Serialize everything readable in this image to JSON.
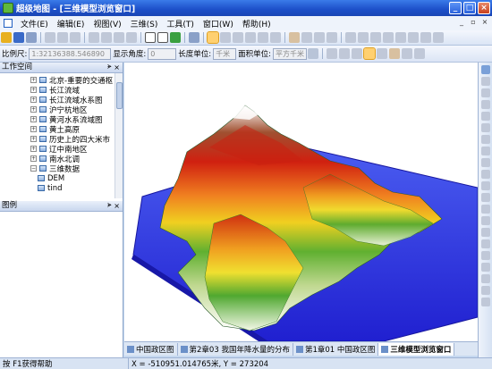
{
  "window": {
    "title": "超级地图 - [三维模型浏览窗口]",
    "minimize": "_",
    "maximize": "□",
    "close": "×"
  },
  "menu": {
    "items": [
      "文件(E)",
      "编辑(E)",
      "视图(V)",
      "三维(S)",
      "工具(T)",
      "窗口(W)",
      "帮助(H)"
    ],
    "mdi_buttons": [
      "_",
      "▫",
      "×"
    ]
  },
  "toolbar2": {
    "scale_label": "比例尺:",
    "scale_value": "1:32136388.546890",
    "display_angle_label": "显示角度:",
    "display_angle_value": "0",
    "length_unit_label": "长度单位:",
    "length_unit_value": "千米",
    "area_unit_label": "面积单位:",
    "area_unit_value": "平方千米"
  },
  "workspace": {
    "title": "工作空间",
    "pin": "ᗘ",
    "close": "×",
    "tree": [
      {
        "label": "北京-重要的交通枢",
        "expander": "+",
        "level": 0
      },
      {
        "label": "长江流域",
        "expander": "+",
        "level": 0
      },
      {
        "label": "长江流域水系图",
        "expander": "+",
        "level": 0
      },
      {
        "label": "沪宁杭地区",
        "expander": "+",
        "level": 0
      },
      {
        "label": "黄河水系流域图",
        "expander": "+",
        "level": 0
      },
      {
        "label": "黄土高原",
        "expander": "+",
        "level": 0
      },
      {
        "label": "历史上的四大米市",
        "expander": "+",
        "level": 0
      },
      {
        "label": "辽中南地区",
        "expander": "+",
        "level": 0
      },
      {
        "label": "南水北调",
        "expander": "+",
        "level": 0
      },
      {
        "label": "三维数据",
        "expander": "−",
        "level": 0
      },
      {
        "label": "DEM",
        "expander": "",
        "level": 1
      },
      {
        "label": "tind",
        "expander": "",
        "level": 1
      }
    ]
  },
  "legend": {
    "title": "图例",
    "pin": "ᗘ",
    "close": "×"
  },
  "doc_tabs": [
    {
      "label": "中国政区图",
      "active": false
    },
    {
      "label": "第2章03 我国年降水量的分布",
      "active": false
    },
    {
      "label": "第1章01 中国政区图",
      "active": false
    },
    {
      "label": "三维模型浏览窗口",
      "active": true
    }
  ],
  "status": {
    "help": "按 F1获得帮助",
    "coords": "X = -510951.014765米, Y = 273204"
  },
  "colors": {
    "title_bar": "#1c4fc8",
    "water": "#3030e0",
    "terrain_peak": "#ffffff",
    "terrain_high": "#c02010",
    "terrain_mid": "#f0c020",
    "terrain_low": "#30a030"
  }
}
